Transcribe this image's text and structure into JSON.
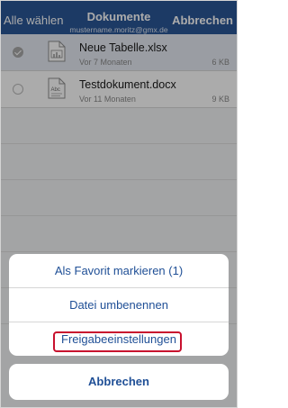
{
  "header": {
    "left_label": "Alle wählen",
    "title": "Dokumente",
    "account": "mustername.moritz@gmx.de",
    "right_label": "Abbrechen"
  },
  "files": [
    {
      "name": "Neue Tabelle.xlsx",
      "date": "Vor 7 Monaten",
      "size": "6 KB",
      "selected": true,
      "icon": "spreadsheet-file-icon"
    },
    {
      "name": "Testdokument.docx",
      "date": "Vor 11 Monaten",
      "size": "9 KB",
      "selected": false,
      "icon": "text-document-file-icon",
      "icon_text": "Abc"
    }
  ],
  "action_sheet": {
    "actions": [
      {
        "label": "Als Favorit markieren (1)"
      },
      {
        "label": "Datei umbenennen"
      },
      {
        "label": "Freigabeeinstellungen",
        "highlighted": true
      }
    ],
    "cancel_label": "Abbrechen"
  },
  "colors": {
    "header_bg": "#2b5797",
    "action_text": "#1f4f96",
    "highlight_border": "#c8102e"
  }
}
